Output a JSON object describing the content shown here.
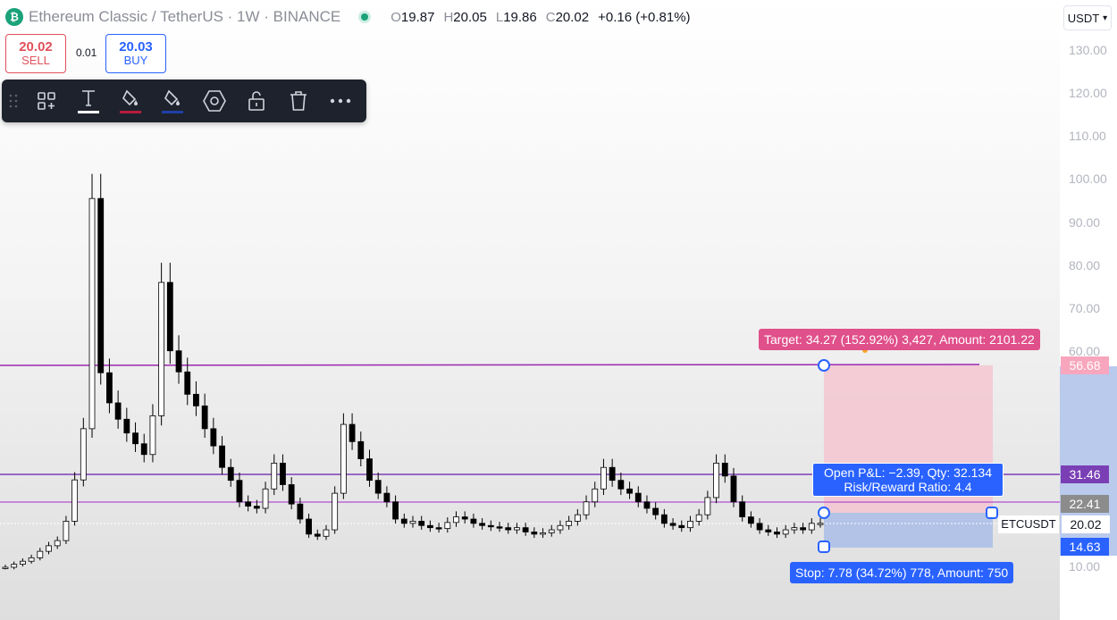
{
  "header": {
    "symbol_title": "Ethereum Classic / TetherUS · 1W · BINANCE",
    "ohlc": [
      {
        "key": "O",
        "value": "19.87"
      },
      {
        "key": "H",
        "value": "20.05"
      },
      {
        "key": "L",
        "value": "19.86"
      },
      {
        "key": "C",
        "value": "20.02"
      }
    ],
    "change": "+0.16 (+0.81%)"
  },
  "trade": {
    "sell_price": "20.02",
    "sell_label": "SELL",
    "buy_price": "20.03",
    "buy_label": "BUY",
    "spread": "0.01"
  },
  "toolbar": {
    "items": [
      "drag-handle-icon",
      "add-object-icon",
      "text-icon",
      "line-color-icon",
      "fill-color-icon",
      "settings-hexagon-icon",
      "lock-icon",
      "delete-icon",
      "more-icon"
    ]
  },
  "currency_selector": {
    "value": "USDT",
    "icon": "chevron-down-icon"
  },
  "price_axis": {
    "ticks": [
      "130.00",
      "120.00",
      "110.00",
      "100.00",
      "90.00",
      "80.00",
      "70.00",
      "60.00",
      "10.00"
    ]
  },
  "levels": {
    "target": {
      "label": "56.68",
      "color": "#f7a6bd",
      "line_color": "#9c27b0"
    },
    "level_31": {
      "label": "31.46",
      "color": "#7b3fb5"
    },
    "level_22": {
      "label": "22.41",
      "color": "#9e9e9e"
    },
    "current": {
      "label": "20.02",
      "symbol": "ETCUSDT"
    },
    "stop": {
      "label": "14.63",
      "color": "#2962ff"
    }
  },
  "position": {
    "target_text": "Target: 34.27 (152.92%) 3,427, Amount: 2101.22",
    "pl_line1": "Open P&L: −2.39, Qty: 32.134",
    "pl_line2": "Risk/Reward Ratio: 4.4",
    "stop_text": "Stop: 7.78 (34.72%) 778, Amount: 750",
    "profit_color": "#f4c3cf",
    "loss_color": "#a9bde8"
  },
  "chart_data": {
    "type": "candlestick",
    "ylim": [
      10,
      130
    ],
    "close_series": [
      9.8,
      10.5,
      11.2,
      12.0,
      13.5,
      14.8,
      16.0,
      20.5,
      30.1,
      42.0,
      95.5,
      55.0,
      48.0,
      44.2,
      41.0,
      38.5,
      36.0,
      45.0,
      76.0,
      60.1,
      55.2,
      50.0,
      47.3,
      42.0,
      38.0,
      33.0,
      30.0,
      25.0,
      24.0,
      23.5,
      28.0,
      34.0,
      29.0,
      24.5,
      21.0,
      17.5,
      17.0,
      18.5,
      27.0,
      43.0,
      39.0,
      35.0,
      30.0,
      27.0,
      25.0,
      21.0,
      20.0,
      20.5,
      19.5,
      19.0,
      18.8,
      20.2,
      21.5,
      21.0,
      20.0,
      19.5,
      19.2,
      19.0,
      18.5,
      19.0,
      18.0,
      17.5,
      17.8,
      18.5,
      19.5,
      20.5,
      22.0,
      25.0,
      28.0,
      33.0,
      30.0,
      28.0,
      27.0,
      25.0,
      23.5,
      22.0,
      20.0,
      19.5,
      19.0,
      20.5,
      22.0,
      26.0,
      34.0,
      31.0,
      25.0,
      21.5,
      20.0,
      18.5,
      18.0,
      17.5,
      18.5,
      19.0,
      18.5,
      20.0,
      20.02
    ]
  }
}
